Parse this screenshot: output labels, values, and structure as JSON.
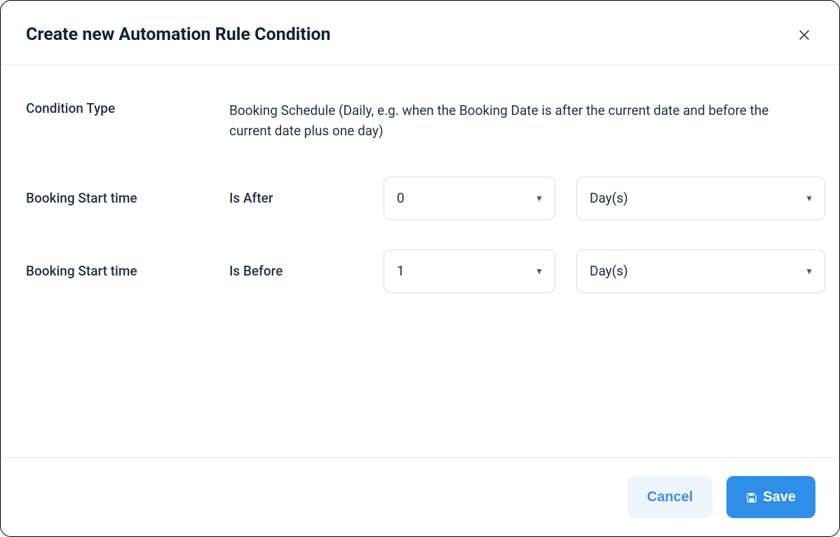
{
  "header": {
    "title": "Create new Automation Rule Condition"
  },
  "form": {
    "conditionType": {
      "label": "Condition Type",
      "description": "Booking Schedule (Daily, e.g. when the Booking Date is after the current date and before the current date plus one day)"
    },
    "rows": [
      {
        "fieldLabel": "Booking Start time",
        "operator": "Is After",
        "value": "0",
        "unit": "Day(s)"
      },
      {
        "fieldLabel": "Booking Start time",
        "operator": "Is Before",
        "value": "1",
        "unit": "Day(s)"
      }
    ]
  },
  "footer": {
    "cancel": "Cancel",
    "save": "Save"
  }
}
